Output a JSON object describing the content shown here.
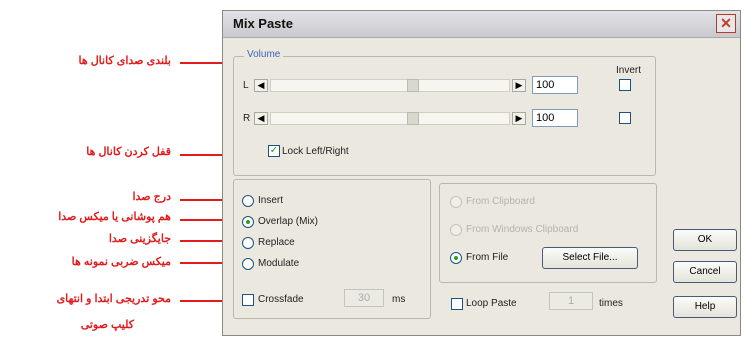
{
  "dialog": {
    "title": "Mix Paste",
    "close_glyph": "✕",
    "volume": {
      "legend": "Volume",
      "invert_label": "Invert",
      "left_label": "L",
      "right_label": "R",
      "left_value": "100",
      "right_value": "100",
      "arrow_left_glyph": "◀",
      "arrow_right_glyph": "▶",
      "left_invert_checked": false,
      "right_invert_checked": false,
      "lock_label": "Lock Left/Right",
      "lock_checked": true
    },
    "mode": {
      "options": [
        "Insert",
        "Overlap (Mix)",
        "Replace",
        "Modulate"
      ],
      "selected": "Overlap (Mix)",
      "crossfade_label": "Crossfade",
      "crossfade_value": "30",
      "crossfade_unit": "ms",
      "crossfade_checked": false
    },
    "source": {
      "from_clipboard": "From Clipboard",
      "from_windows_clipboard": "From Windows Clipboard",
      "from_file": "From File",
      "select_file_button": "Select File...",
      "selected": "From File",
      "loop_label": "Loop Paste",
      "loop_value": "1",
      "loop_unit": "times",
      "loop_checked": false
    },
    "buttons": {
      "ok": "OK",
      "cancel": "Cancel",
      "help": "Help"
    }
  },
  "annotations": {
    "volume_level": "بلندی صدای کانال ها",
    "lock_channels": "قفل کردن کانال ها",
    "insert_sound": "درج صدا",
    "overlap_mix": "هم پوشانی یا میکس صدا",
    "replace_sound": "جایگزینی صدا",
    "modulate": "میکس ضربی نمونه ها",
    "crossfade_line1": "محو تدریجی ابتدا و انتهای",
    "crossfade_line2": "کلیپ صوتی"
  },
  "colors": {
    "annotation": "#e21b1b",
    "accent": "#4063b8",
    "check": "#21a121"
  }
}
